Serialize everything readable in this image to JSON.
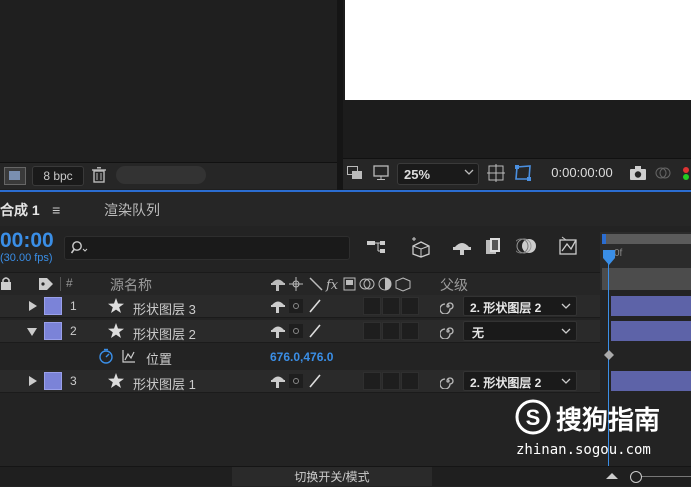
{
  "project_panel": {
    "bpc_label": "8 bpc"
  },
  "viewer": {
    "zoom": "25%",
    "timecode": "0:00:00:00"
  },
  "tabs": {
    "comp": "合成 1",
    "menu_icon": "≡",
    "render_queue": "渲染队列"
  },
  "timeline_header": {
    "timecode": "00:00",
    "fps": "(30.00 fps)",
    "search_placeholder": "",
    "hash_label": "#",
    "source_name_label": "源名称",
    "parent_label": "父级",
    "time_start_label": "0f"
  },
  "layers": [
    {
      "num": "1",
      "name": "形状图层 3",
      "parent": "2. 形状图层 2",
      "expanded": false
    },
    {
      "num": "2",
      "name": "形状图层 2",
      "parent": "无",
      "expanded": true
    },
    {
      "num": "3",
      "name": "形状图层 1",
      "parent": "2. 形状图层 2",
      "expanded": false
    }
  ],
  "property": {
    "name": "位置",
    "value": "676.0,476.0"
  },
  "footer": {
    "toggle_label": "切换开关/模式"
  },
  "watermark": {
    "brand": "搜狗指南",
    "url": "zhinan.sogou.com"
  },
  "colors": {
    "accent_blue": "#2b6dd1",
    "layer_color": "#7b83d8",
    "bar_color": "#5d63a8",
    "timecode_blue": "#3a8ee6"
  }
}
